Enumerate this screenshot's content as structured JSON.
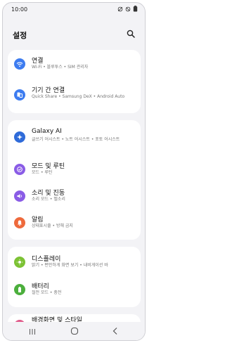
{
  "status_bar": {
    "time": "10:00"
  },
  "header": {
    "title": "설정"
  },
  "items": [
    {
      "title": "연결",
      "subtitle": "Wi-Fi • 블루투스 • SIM 관리자",
      "icon": "wifi-icon",
      "color": "#3d7cf0"
    },
    {
      "title": "기기 간 연결",
      "subtitle": "Quick Share • Samsung DeX • Android Auto",
      "icon": "device-connect-icon",
      "color": "#3d7cf0"
    },
    {
      "title": "Galaxy AI",
      "subtitle": "글쓰기 어시스트 • 노트 어시스트 • 포토 어시스트",
      "icon": "galaxy-ai-icon",
      "color": "#2f6bd9"
    },
    {
      "title": "모드 및 루틴",
      "subtitle": "모드 • 루틴",
      "icon": "modes-icon",
      "color": "#8a5ce6"
    },
    {
      "title": "소리 및 진동",
      "subtitle": "소리 모드 • 벨소리",
      "icon": "sound-icon",
      "color": "#8a5ce6"
    },
    {
      "title": "알림",
      "subtitle": "상태표시줄 • 방해 금지",
      "icon": "bell-icon",
      "color": "#ee6a3c"
    },
    {
      "title": "디스플레이",
      "subtitle": "밝기 • 편안하게 화면 보기 • 내비게이션 바",
      "icon": "display-icon",
      "color": "#7cc234"
    },
    {
      "title": "배터리",
      "subtitle": "절전 모드 • 충전",
      "icon": "battery-icon",
      "color": "#4caf3d"
    },
    {
      "title": "배경화면 및 스타일",
      "subtitle": "",
      "icon": "wallpaper-icon",
      "color": "#e05a8a"
    }
  ]
}
